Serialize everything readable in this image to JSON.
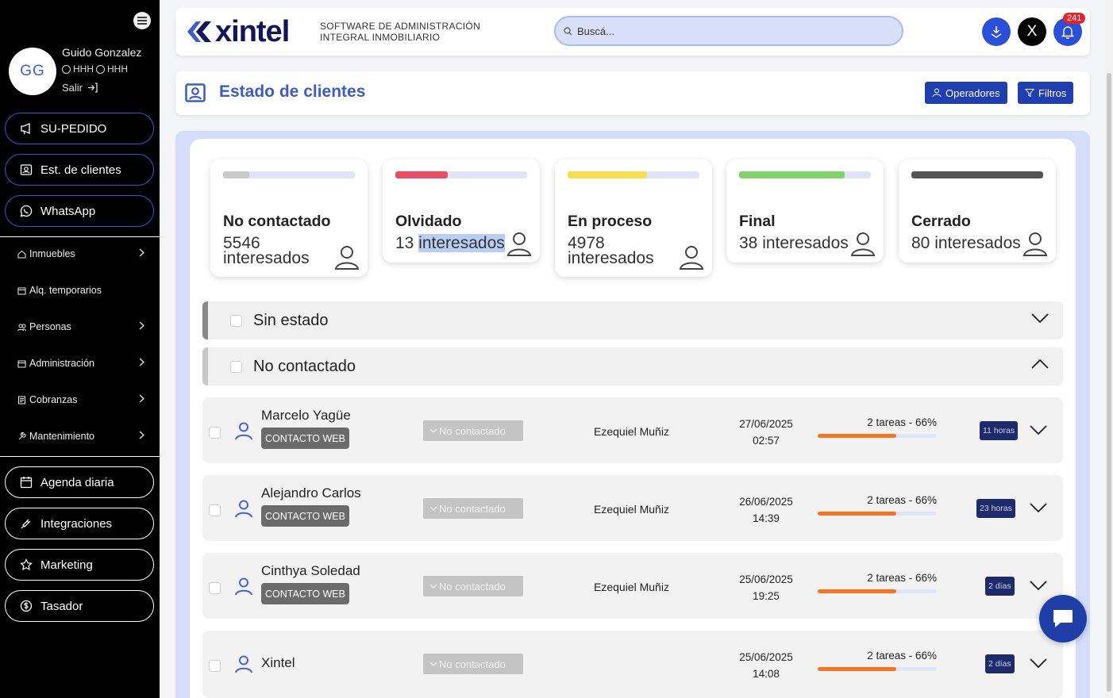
{
  "sidebar": {
    "initials": "GG",
    "user_name": "Guido Gonzalez",
    "line1": "HHH",
    "line2": "HHH",
    "logout": "Salir",
    "quick": [
      {
        "label": "SU-PEDIDO",
        "icon": "megaphone-icon"
      },
      {
        "label": "Est. de clientes",
        "icon": "contact-card-icon"
      },
      {
        "label": "WhatsApp",
        "icon": "whatsapp-icon"
      }
    ],
    "menu": [
      {
        "label": "Inmuebles",
        "icon": "home-icon",
        "has_children": true
      },
      {
        "label": "Alq. temporarios",
        "icon": "calendar-icon",
        "has_children": false
      },
      {
        "label": "Personas",
        "icon": "people-icon",
        "has_children": true
      },
      {
        "label": "Administración",
        "icon": "calendar-icon",
        "has_children": true
      },
      {
        "label": "Cobranzas",
        "icon": "receipt-icon",
        "has_children": true
      },
      {
        "label": "Mantenimiento",
        "icon": "tool-icon",
        "has_children": true
      }
    ],
    "bottom": [
      {
        "label": "Agenda diaria",
        "icon": "calendar-icon"
      },
      {
        "label": "Integraciones",
        "icon": "plug-icon"
      },
      {
        "label": "Marketing",
        "icon": "star-icon"
      },
      {
        "label": "Tasador",
        "icon": "dollar-icon"
      }
    ]
  },
  "header": {
    "logo": "xintel",
    "tagline_1": "SOFTWARE DE ADMINISTRACIÓN",
    "tagline_2": "INTEGRAL INMOBILIARIO",
    "search_placeholder": "Buscá...",
    "notifications": "241",
    "x_label": "X"
  },
  "page": {
    "title": "Estado de clientes",
    "btn_operadores": "Operadores",
    "btn_filtros": "Filtros"
  },
  "cards": [
    {
      "title": "No contactado",
      "count": "5546",
      "unit": "interesados",
      "color": "#c9c9c9",
      "fill": 0.2
    },
    {
      "title": "Olvidado",
      "count": "13",
      "unit": "interesados",
      "color": "#ea4d64",
      "fill": 0.4
    },
    {
      "title": "En proceso",
      "count": "4978",
      "unit": "interesados",
      "color": "#f4df4f",
      "fill": 0.6
    },
    {
      "title": "Final",
      "count": "38",
      "unit": "interesados",
      "color": "#7ed36a",
      "fill": 0.8
    },
    {
      "title": "Cerrado",
      "count": "80",
      "unit": "interesados",
      "color": "#555555",
      "fill": 1.0
    }
  ],
  "groups": [
    {
      "title": "Sin estado",
      "expanded": false
    },
    {
      "title": "No contactado",
      "expanded": true
    }
  ],
  "rows": [
    {
      "name": "Marcelo Yagüe",
      "tag": "CONTACTO WEB",
      "status": "No contactado",
      "operator": "Ezequiel Muñiz",
      "date": "27/06/2025",
      "time": "02:57",
      "tasks": "2 tareas - 66%",
      "progress": 0.66,
      "elapsed": "11 horas"
    },
    {
      "name": "Alejandro Carlos",
      "tag": "CONTACTO WEB",
      "status": "No contactado",
      "operator": "Ezequiel Muñiz",
      "date": "26/06/2025",
      "time": "14:39",
      "tasks": "2 tareas - 66%",
      "progress": 0.66,
      "elapsed": "23 horas"
    },
    {
      "name": "Cinthya Soledad",
      "tag": "CONTACTO WEB",
      "status": "No contactado",
      "operator": "Ezequiel Muñiz",
      "date": "25/06/2025",
      "time": "19:25",
      "tasks": "2 tareas - 66%",
      "progress": 0.66,
      "elapsed": "2 días"
    },
    {
      "name": "Xintel",
      "tag": "",
      "status": "No contactado",
      "operator": "",
      "date": "25/06/2025",
      "time": "14:08",
      "tasks": "2 tareas - 66%",
      "progress": 0.66,
      "elapsed": "2 días"
    }
  ],
  "colors": {
    "accent": "#3c5ad4",
    "dark_blue": "#1f3fb0",
    "progress": "#f7751f"
  }
}
